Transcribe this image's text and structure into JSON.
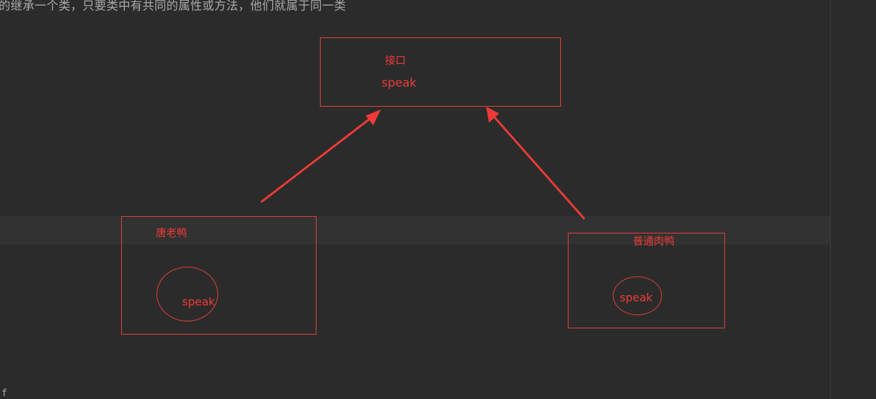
{
  "editor": {
    "top_text": "的继承一个类，只要类中有共同的属性或方法，他们就属于同一类",
    "bottom_fragment": "f"
  },
  "diagram": {
    "interface": {
      "title": "接口",
      "method": "speak"
    },
    "left_class": {
      "title": "唐老鸭",
      "method": "speak"
    },
    "right_class": {
      "title": "普通肉鸭",
      "method": "speak"
    }
  },
  "colors": {
    "background": "#2b2b2b",
    "current_line": "#323232",
    "text": "#a9a9a9",
    "annotation_red": "#e8413b"
  }
}
